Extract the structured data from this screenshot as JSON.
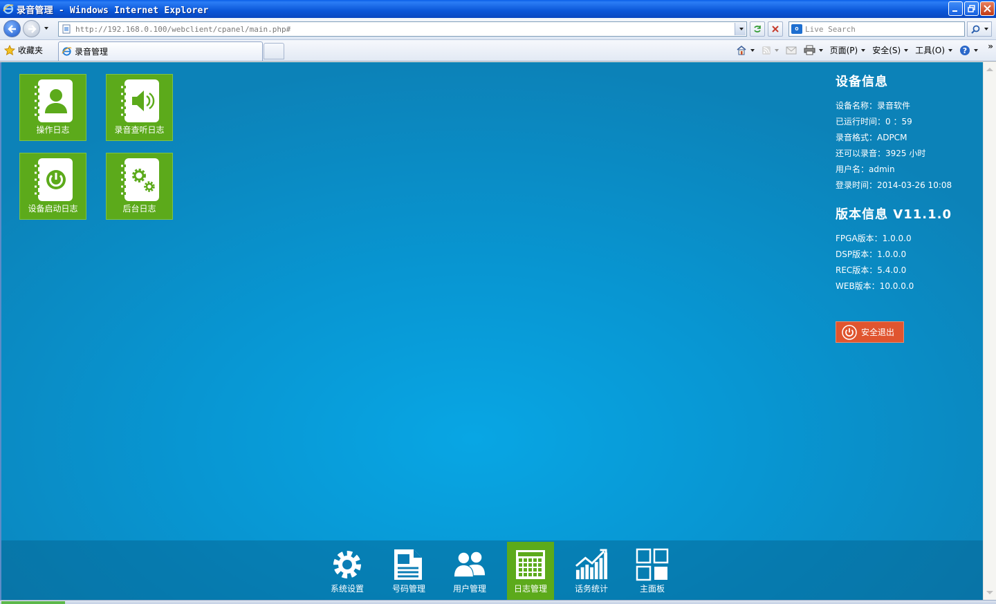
{
  "window": {
    "title": "录音管理 - Windows Internet Explorer"
  },
  "browser": {
    "url": "http://192.168.0.100/webclient/cpanel/main.php#",
    "search_placeholder": "Live Search",
    "favorites_label": "收藏夹",
    "tab_title": "录音管理",
    "commands": {
      "page": "页面(P)",
      "safety": "安全(S)",
      "tools": "工具(O)"
    }
  },
  "tiles": [
    {
      "label": "操作日志",
      "icon": "contact-book-icon"
    },
    {
      "label": "录音查听日志",
      "icon": "speaker-book-icon"
    },
    {
      "label": "设备启动日志",
      "icon": "power-book-icon"
    },
    {
      "label": "后台日志",
      "icon": "gears-book-icon"
    }
  ],
  "device_info": {
    "heading": "设备信息",
    "rows": [
      "设备名称：录音软件",
      "已运行时间：0 ：59",
      "录音格式：ADPCM",
      "还可以录音：3925 小时",
      "用户名：admin",
      "登录时间：2014-03-26 10:08"
    ]
  },
  "version_info": {
    "heading": "版本信息 V11.1.0",
    "rows": [
      "FPGA版本：1.0.0.0",
      "DSP版本：1.0.0.0",
      "REC版本：5.4.0.0",
      "WEB版本：10.0.0.0"
    ]
  },
  "logout_label": "安全退出",
  "bottom_nav": [
    {
      "label": "系统设置",
      "icon": "gear-icon",
      "active": false
    },
    {
      "label": "号码管理",
      "icon": "document-icon",
      "active": false
    },
    {
      "label": "用户管理",
      "icon": "users-icon",
      "active": false
    },
    {
      "label": "日志管理",
      "icon": "calendar-grid-icon",
      "active": true
    },
    {
      "label": "话务统计",
      "icon": "chart-icon",
      "active": false
    },
    {
      "label": "主面板",
      "icon": "dashboard-icon",
      "active": false
    }
  ],
  "colors": {
    "tile_green": "#5caa1b",
    "content_blue": "#0896d2",
    "logout_red": "#e0552f"
  }
}
